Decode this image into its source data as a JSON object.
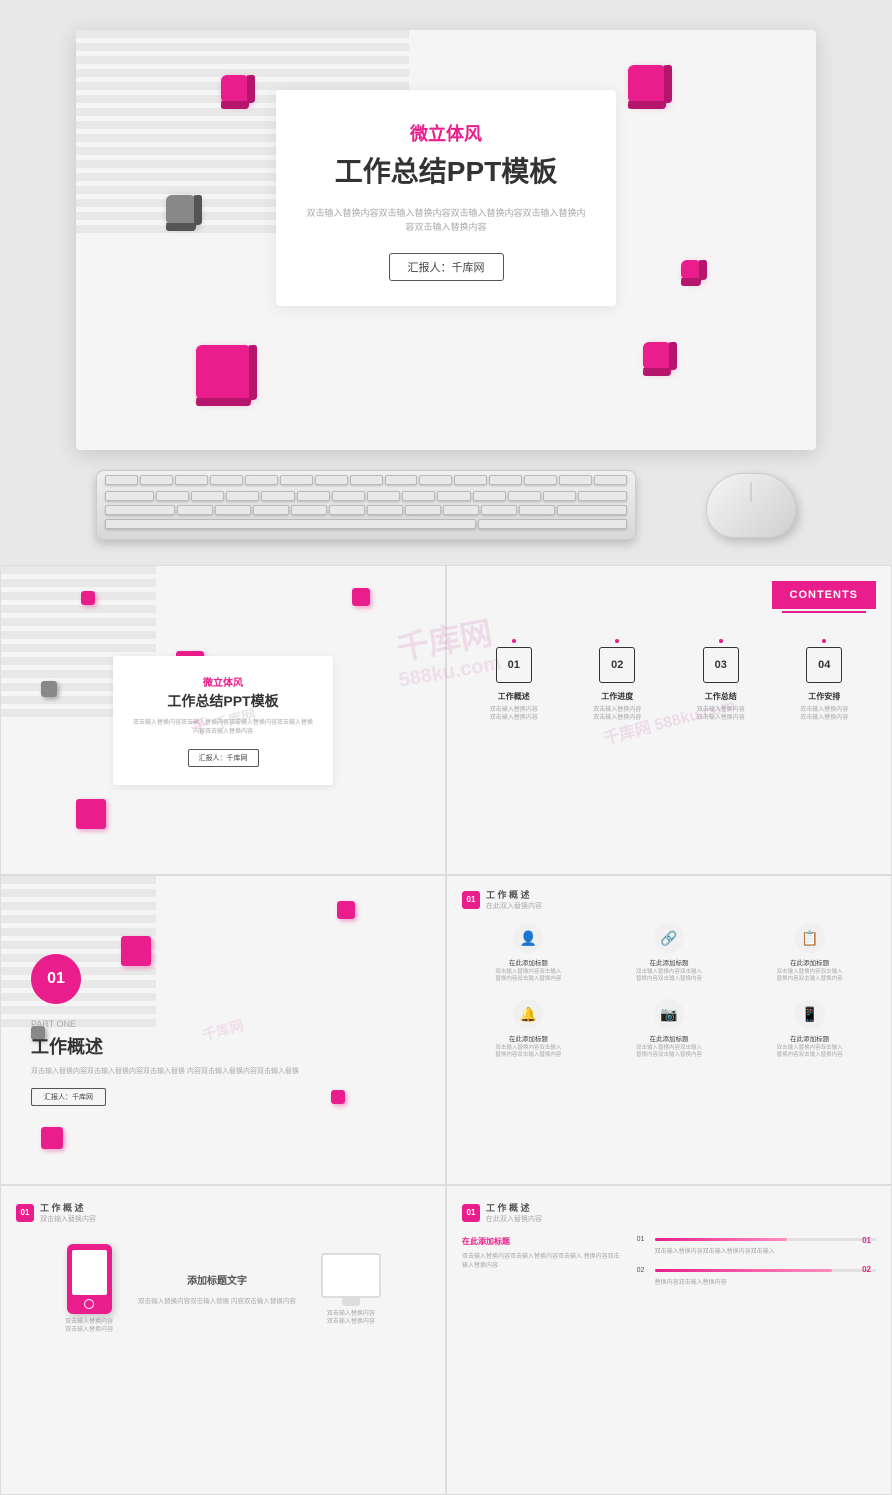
{
  "watermark": {
    "text1": "千库网",
    "text2": "588ku.com",
    "icon": "千"
  },
  "slide1": {
    "subtitle_pink": "微立体风",
    "title_main": "工作总结PPT模板",
    "description": "双击输入替换内容双击输入替换内容双击输入替换内容双击输入替换内容双击输入替换内容",
    "reporter_label": "汇报人：千库网"
  },
  "slide_contents": {
    "badge": "CONTENTS",
    "items": [
      {
        "num": "01",
        "title": "工作概述",
        "desc": "双击输入替换内容\n双击输入替换内容"
      },
      {
        "num": "02",
        "title": "工作进度",
        "desc": "双击输入替换内容\n双击输入替换内容"
      },
      {
        "num": "03",
        "title": "工作总结",
        "desc": "双击输入替换内容\n双击输入替换内容"
      },
      {
        "num": "04",
        "title": "工作安排",
        "desc": "双击输入替换内容\n双击输入替换内容"
      }
    ]
  },
  "slide_part1": {
    "num": "01",
    "part_label": "PART ONE",
    "title_cn": "工作概述",
    "desc": "双击输入替换内容双击输入替换内容双击输入替换\n内容双击输入替换内容双击输入替换"
  },
  "slide_icons": {
    "num": "01",
    "section": "工 作 概 述",
    "sub": "在此双入替换内容",
    "items": [
      {
        "icon": "👤",
        "title": "在此添加标题",
        "desc": "双击输入替换内容双击输入\n替换内容双击输入替换内容"
      },
      {
        "icon": "🔗",
        "title": "在此添加标题",
        "desc": "双击输入替换内容双击输入\n替换内容双击输入替换内容"
      },
      {
        "icon": "📋",
        "title": "在此添加标题",
        "desc": "双击输入替换内容双击输入\n替换内容双击输入替换内容"
      },
      {
        "icon": "🔔",
        "title": "在此添加标题",
        "desc": "双击输入替换内容双击输入\n替换内容双击输入替换内容"
      },
      {
        "icon": "📷",
        "title": "在此添加标题",
        "desc": "双击输入替换内容双击输入\n替换内容双击输入替换内容"
      },
      {
        "icon": "📱",
        "title": "在此添加标题",
        "desc": "双击输入替换内容双击输入\n替换内容双击输入替换内容"
      }
    ]
  },
  "slide_device": {
    "num": "01",
    "section": "工 作 概 述",
    "sub": "双击输入替换内容",
    "add_title": "添加标题文字",
    "desc1": "双击输入替换内容双击输入替换\n内容双击输入替换内容",
    "desc2": "双击输入替换内容\n双击输入替换内容"
  },
  "slide_chart": {
    "num": "01",
    "section": "工 作 概 述",
    "sub": "在此双入替换内容",
    "add_title": "在此添加标题",
    "desc": "双击输入替换内容双击输入替换内容双击输入\n替换内容双击输入替换内容",
    "items": [
      {
        "label": "01",
        "width": 60,
        "val": ""
      },
      {
        "label": "02",
        "width": 80,
        "val": ""
      }
    ]
  },
  "colors": {
    "pink": "#e91e8c",
    "gray": "#888888",
    "light_bg": "#f5f5f5",
    "stripe": "#e0e0e0"
  }
}
